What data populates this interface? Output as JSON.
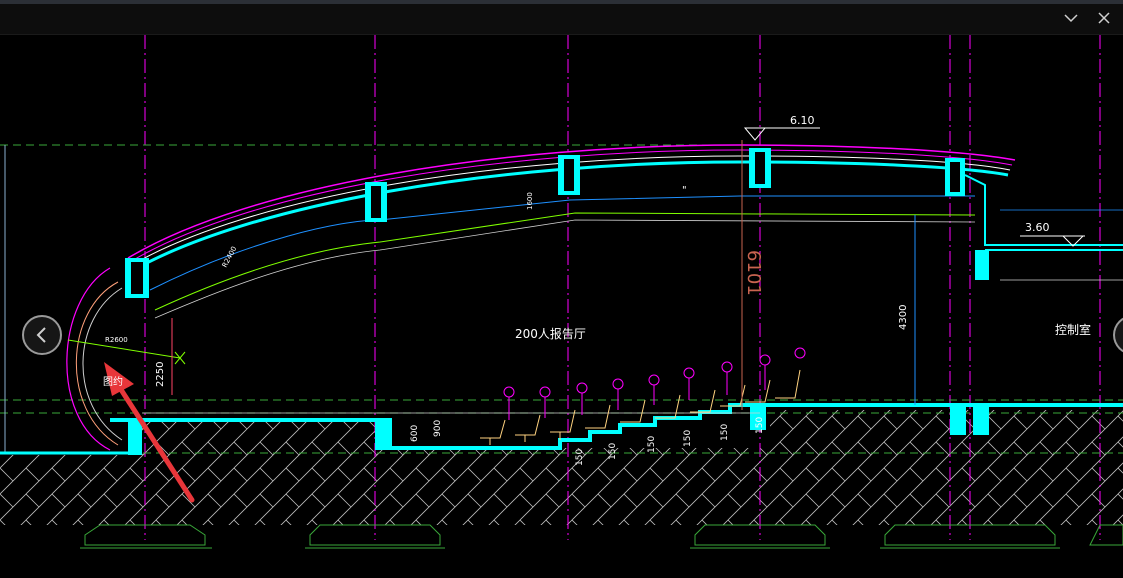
{
  "window": {
    "minimize_label": "–",
    "chevron_icon": "chevron-down-icon",
    "close_icon": "close-icon"
  },
  "drawing": {
    "elevation_top": "6.10",
    "elevation_right": "3.60",
    "hall_label": "200人报告厅",
    "control_room_label": "控制室",
    "dim_vertical_red": "6101",
    "dim_4300": "4300",
    "dim_2250": "2250",
    "dim_600": "600",
    "dim_900": "900",
    "dim_r2600": "R2600",
    "dim_roof_1": "1600",
    "dim_roof_2": "R2400",
    "small_label_1": "图约",
    "step_dims": [
      "150",
      "150",
      "150",
      "150",
      "150",
      "150"
    ],
    "quote_mark": "\""
  },
  "colors": {
    "axis": "#ff00ff",
    "wall_cyan": "#00ffff",
    "structure_blue": "#1e90ff",
    "green_line": "#7fff00",
    "hatch": "#d0d0d0",
    "annotation_arrow": "#e8363a",
    "text_white": "#ffffff",
    "dim_red": "#c86450"
  },
  "navigation": {
    "prev_icon": "chevron-left-icon",
    "next_icon": "chevron-right-icon"
  }
}
